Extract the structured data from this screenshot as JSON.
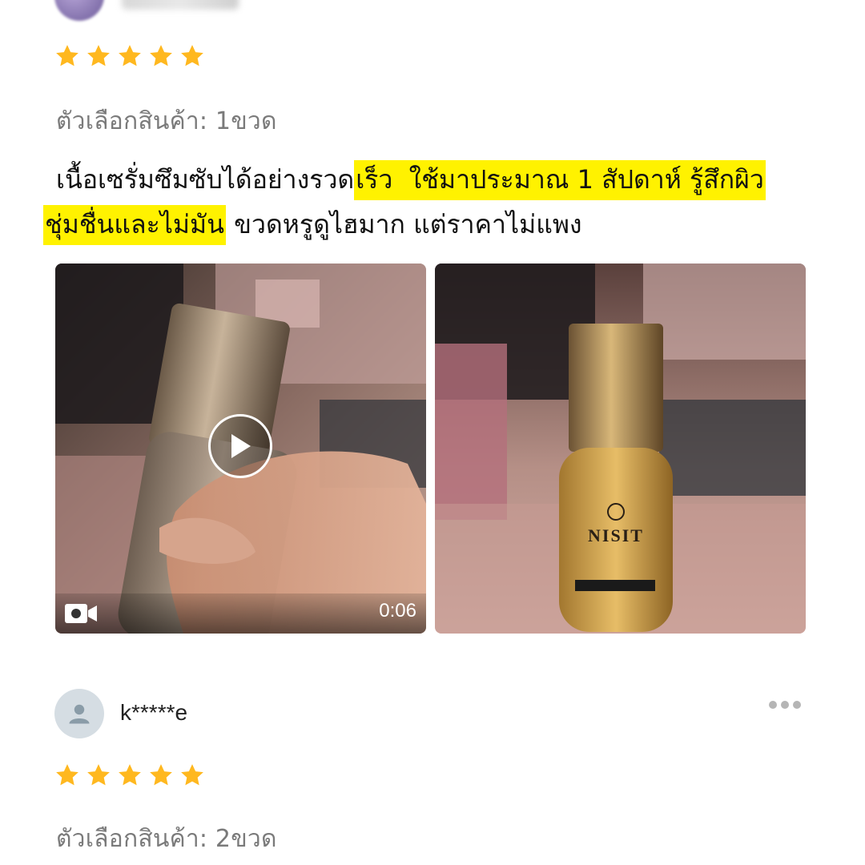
{
  "review1": {
    "rating": 5,
    "variant_label": "ตัวเลือกสินค้า: 1ขวด",
    "text_line1_a": "เนื้อเซรั่มซึมซับได้อย่างรวด",
    "text_line1_b": "เร็ว",
    "text_line1_c": "ใช้มาประมาณ 1 สัปดาห์ รู้สึกผิว",
    "text_line2_a": "ชุ่มชื่นและไม่มัน",
    "text_line2_b": " ขวดหรูดูไฮมาก แต่ราคาไม่แพง",
    "media": [
      {
        "type": "video",
        "duration": "0:06",
        "icon": "play-icon",
        "badge_icon": "video-camera-icon"
      },
      {
        "type": "photo"
      }
    ]
  },
  "review2": {
    "username": "k*****e",
    "rating": 5,
    "variant_label": "ตัวเลือกสินค้า: 2ขวด",
    "more_icon": "more-options-icon"
  },
  "colors": {
    "star": "#ffb81f",
    "highlight": "#fff200"
  }
}
